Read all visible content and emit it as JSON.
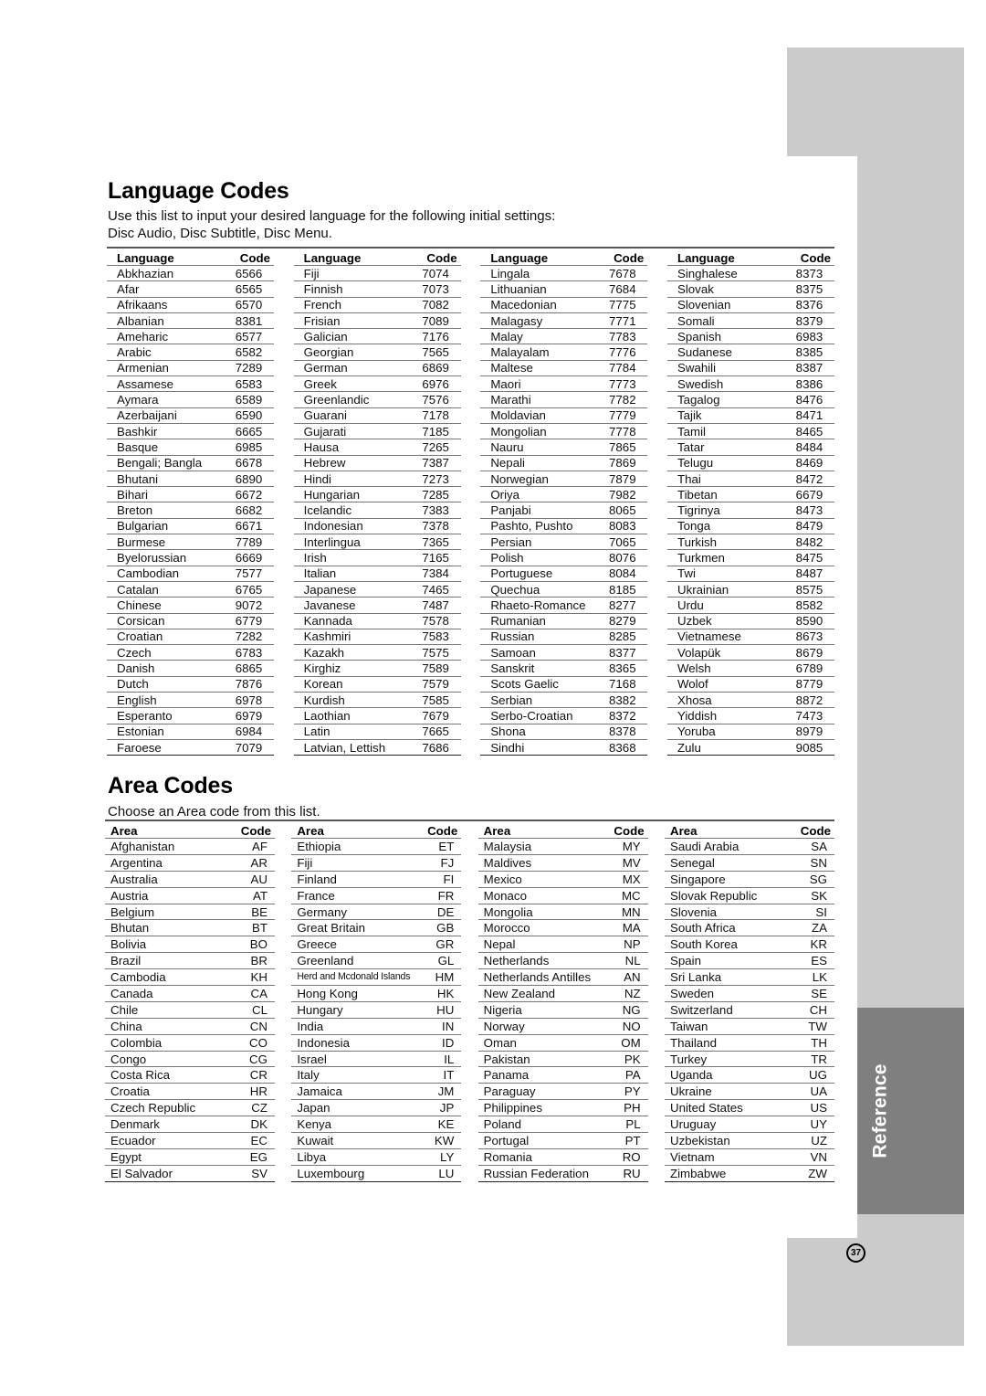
{
  "language_section": {
    "title": "Language Codes",
    "intro_line1": "Use this list to input your desired language for the following initial settings:",
    "intro_line2": "Disc Audio, Disc Subtitle, Disc Menu.",
    "header_name": "Language",
    "header_code": "Code",
    "columns": [
      [
        [
          "Abkhazian",
          "6566"
        ],
        [
          "Afar",
          "6565"
        ],
        [
          "Afrikaans",
          "6570"
        ],
        [
          "Albanian",
          "8381"
        ],
        [
          "Ameharic",
          "6577"
        ],
        [
          "Arabic",
          "6582"
        ],
        [
          "Armenian",
          "7289"
        ],
        [
          "Assamese",
          "6583"
        ],
        [
          "Aymara",
          "6589"
        ],
        [
          "Azerbaijani",
          "6590"
        ],
        [
          "Bashkir",
          "6665"
        ],
        [
          "Basque",
          "6985"
        ],
        [
          "Bengali; Bangla",
          "6678"
        ],
        [
          "Bhutani",
          "6890"
        ],
        [
          "Bihari",
          "6672"
        ],
        [
          "Breton",
          "6682"
        ],
        [
          "Bulgarian",
          "6671"
        ],
        [
          "Burmese",
          "7789"
        ],
        [
          "Byelorussian",
          "6669"
        ],
        [
          "Cambodian",
          "7577"
        ],
        [
          "Catalan",
          "6765"
        ],
        [
          "Chinese",
          "9072"
        ],
        [
          "Corsican",
          "6779"
        ],
        [
          "Croatian",
          "7282"
        ],
        [
          "Czech",
          "6783"
        ],
        [
          "Danish",
          "6865"
        ],
        [
          "Dutch",
          "7876"
        ],
        [
          "English",
          "6978"
        ],
        [
          "Esperanto",
          "6979"
        ],
        [
          "Estonian",
          "6984"
        ],
        [
          "Faroese",
          "7079"
        ]
      ],
      [
        [
          "Fiji",
          "7074"
        ],
        [
          "Finnish",
          "7073"
        ],
        [
          "French",
          "7082"
        ],
        [
          "Frisian",
          "7089"
        ],
        [
          "Galician",
          "7176"
        ],
        [
          "Georgian",
          "7565"
        ],
        [
          "German",
          "6869"
        ],
        [
          "Greek",
          "6976"
        ],
        [
          "Greenlandic",
          "7576"
        ],
        [
          "Guarani",
          "7178"
        ],
        [
          "Gujarati",
          "7185"
        ],
        [
          "Hausa",
          "7265"
        ],
        [
          "Hebrew",
          "7387"
        ],
        [
          "Hindi",
          "7273"
        ],
        [
          "Hungarian",
          "7285"
        ],
        [
          "Icelandic",
          "7383"
        ],
        [
          "Indonesian",
          "7378"
        ],
        [
          "Interlingua",
          "7365"
        ],
        [
          "Irish",
          "7165"
        ],
        [
          "Italian",
          "7384"
        ],
        [
          "Japanese",
          "7465"
        ],
        [
          "Javanese",
          "7487"
        ],
        [
          "Kannada",
          "7578"
        ],
        [
          "Kashmiri",
          "7583"
        ],
        [
          "Kazakh",
          "7575"
        ],
        [
          "Kirghiz",
          "7589"
        ],
        [
          "Korean",
          "7579"
        ],
        [
          "Kurdish",
          "7585"
        ],
        [
          "Laothian",
          "7679"
        ],
        [
          "Latin",
          "7665"
        ],
        [
          "Latvian, Lettish",
          "7686"
        ]
      ],
      [
        [
          "Lingala",
          "7678"
        ],
        [
          "Lithuanian",
          "7684"
        ],
        [
          "Macedonian",
          "7775"
        ],
        [
          "Malagasy",
          "7771"
        ],
        [
          "Malay",
          "7783"
        ],
        [
          "Malayalam",
          "7776"
        ],
        [
          "Maltese",
          "7784"
        ],
        [
          "Maori",
          "7773"
        ],
        [
          "Marathi",
          "7782"
        ],
        [
          "Moldavian",
          "7779"
        ],
        [
          "Mongolian",
          "7778"
        ],
        [
          "Nauru",
          "7865"
        ],
        [
          "Nepali",
          "7869"
        ],
        [
          "Norwegian",
          "7879"
        ],
        [
          "Oriya",
          "7982"
        ],
        [
          "Panjabi",
          "8065"
        ],
        [
          "Pashto, Pushto",
          "8083"
        ],
        [
          "Persian",
          "7065"
        ],
        [
          "Polish",
          "8076"
        ],
        [
          "Portuguese",
          "8084"
        ],
        [
          "Quechua",
          "8185"
        ],
        [
          "Rhaeto-Romance",
          "8277"
        ],
        [
          "Rumanian",
          "8279"
        ],
        [
          "Russian",
          "8285"
        ],
        [
          "Samoan",
          "8377"
        ],
        [
          "Sanskrit",
          "8365"
        ],
        [
          "Scots Gaelic",
          "7168"
        ],
        [
          "Serbian",
          "8382"
        ],
        [
          "Serbo-Croatian",
          "8372"
        ],
        [
          "Shona",
          "8378"
        ],
        [
          "Sindhi",
          "8368"
        ]
      ],
      [
        [
          "Singhalese",
          "8373"
        ],
        [
          "Slovak",
          "8375"
        ],
        [
          "Slovenian",
          "8376"
        ],
        [
          "Somali",
          "8379"
        ],
        [
          "Spanish",
          "6983"
        ],
        [
          "Sudanese",
          "8385"
        ],
        [
          "Swahili",
          "8387"
        ],
        [
          "Swedish",
          "8386"
        ],
        [
          "Tagalog",
          "8476"
        ],
        [
          "Tajik",
          "8471"
        ],
        [
          "Tamil",
          "8465"
        ],
        [
          "Tatar",
          "8484"
        ],
        [
          "Telugu",
          "8469"
        ],
        [
          "Thai",
          "8472"
        ],
        [
          "Tibetan",
          "6679"
        ],
        [
          "Tigrinya",
          "8473"
        ],
        [
          "Tonga",
          "8479"
        ],
        [
          "Turkish",
          "8482"
        ],
        [
          "Turkmen",
          "8475"
        ],
        [
          "Twi",
          "8487"
        ],
        [
          "Ukrainian",
          "8575"
        ],
        [
          "Urdu",
          "8582"
        ],
        [
          "Uzbek",
          "8590"
        ],
        [
          "Vietnamese",
          "8673"
        ],
        [
          "Volapük",
          "8679"
        ],
        [
          "Welsh",
          "6789"
        ],
        [
          "Wolof",
          "8779"
        ],
        [
          "Xhosa",
          "8872"
        ],
        [
          "Yiddish",
          "7473"
        ],
        [
          "Yoruba",
          "8979"
        ],
        [
          "Zulu",
          "9085"
        ]
      ]
    ]
  },
  "area_section": {
    "title": "Area Codes",
    "intro": "Choose an Area code from this list.",
    "header_name": "Area",
    "header_code": "Code",
    "columns": [
      [
        [
          "Afghanistan",
          "AF"
        ],
        [
          "Argentina",
          "AR"
        ],
        [
          "Australia",
          "AU"
        ],
        [
          "Austria",
          "AT"
        ],
        [
          "Belgium",
          "BE"
        ],
        [
          "Bhutan",
          "BT"
        ],
        [
          "Bolivia",
          "BO"
        ],
        [
          "Brazil",
          "BR"
        ],
        [
          "Cambodia",
          "KH"
        ],
        [
          "Canada",
          "CA"
        ],
        [
          "Chile",
          "CL"
        ],
        [
          "China",
          "CN"
        ],
        [
          "Colombia",
          "CO"
        ],
        [
          "Congo",
          "CG"
        ],
        [
          "Costa Rica",
          "CR"
        ],
        [
          "Croatia",
          "HR"
        ],
        [
          "Czech Republic",
          "CZ"
        ],
        [
          "Denmark",
          "DK"
        ],
        [
          "Ecuador",
          "EC"
        ],
        [
          "Egypt",
          "EG"
        ],
        [
          "El Salvador",
          "SV"
        ]
      ],
      [
        [
          "Ethiopia",
          "ET"
        ],
        [
          "Fiji",
          "FJ"
        ],
        [
          "Finland",
          "FI"
        ],
        [
          "France",
          "FR"
        ],
        [
          "Germany",
          "DE"
        ],
        [
          "Great Britain",
          "GB"
        ],
        [
          "Greece",
          "GR"
        ],
        [
          "Greenland",
          "GL"
        ],
        [
          "Herd and Mcdonald Islands",
          "HM"
        ],
        [
          "Hong Kong",
          "HK"
        ],
        [
          "Hungary",
          "HU"
        ],
        [
          "India",
          "IN"
        ],
        [
          "Indonesia",
          "ID"
        ],
        [
          "Israel",
          "IL"
        ],
        [
          "Italy",
          "IT"
        ],
        [
          "Jamaica",
          "JM"
        ],
        [
          "Japan",
          "JP"
        ],
        [
          "Kenya",
          "KE"
        ],
        [
          "Kuwait",
          "KW"
        ],
        [
          "Libya",
          "LY"
        ],
        [
          "Luxembourg",
          "LU"
        ]
      ],
      [
        [
          "Malaysia",
          "MY"
        ],
        [
          "Maldives",
          "MV"
        ],
        [
          "Mexico",
          "MX"
        ],
        [
          "Monaco",
          "MC"
        ],
        [
          "Mongolia",
          "MN"
        ],
        [
          "Morocco",
          "MA"
        ],
        [
          "Nepal",
          "NP"
        ],
        [
          "Netherlands",
          "NL"
        ],
        [
          "Netherlands Antilles",
          "AN"
        ],
        [
          "New Zealand",
          "NZ"
        ],
        [
          "Nigeria",
          "NG"
        ],
        [
          "Norway",
          "NO"
        ],
        [
          "Oman",
          "OM"
        ],
        [
          "Pakistan",
          "PK"
        ],
        [
          "Panama",
          "PA"
        ],
        [
          "Paraguay",
          "PY"
        ],
        [
          "Philippines",
          "PH"
        ],
        [
          "Poland",
          "PL"
        ],
        [
          "Portugal",
          "PT"
        ],
        [
          "Romania",
          "RO"
        ],
        [
          "Russian Federation",
          "RU"
        ]
      ],
      [
        [
          "Saudi Arabia",
          "SA"
        ],
        [
          "Senegal",
          "SN"
        ],
        [
          "Singapore",
          "SG"
        ],
        [
          "Slovak Republic",
          "SK"
        ],
        [
          "Slovenia",
          "SI"
        ],
        [
          "South Africa",
          "ZA"
        ],
        [
          "South Korea",
          "KR"
        ],
        [
          "Spain",
          "ES"
        ],
        [
          "Sri Lanka",
          "LK"
        ],
        [
          "Sweden",
          "SE"
        ],
        [
          "Switzerland",
          "CH"
        ],
        [
          "Taiwan",
          "TW"
        ],
        [
          "Thailand",
          "TH"
        ],
        [
          "Turkey",
          "TR"
        ],
        [
          "Uganda",
          "UG"
        ],
        [
          "Ukraine",
          "UA"
        ],
        [
          "United States",
          "US"
        ],
        [
          "Uruguay",
          "UY"
        ],
        [
          "Uzbekistan",
          "UZ"
        ],
        [
          "Vietnam",
          "VN"
        ],
        [
          "Zimbabwe",
          "ZW"
        ]
      ]
    ]
  },
  "side_tab": {
    "label": "Reference",
    "page_number": "37"
  }
}
